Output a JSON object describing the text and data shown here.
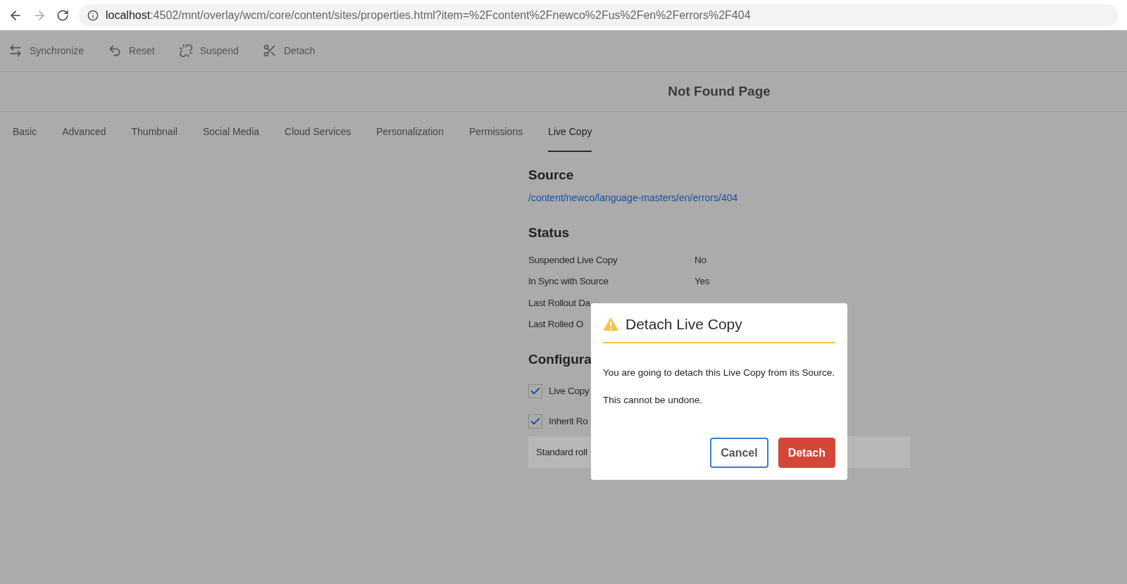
{
  "browser": {
    "host": "localhost",
    "path": ":4502/mnt/overlay/wcm/core/content/sites/properties.html?item=%2Fcontent%2Fnewco%2Fus%2Fen%2Ferrors%2F404"
  },
  "toolbar": [
    {
      "label": "Synchronize",
      "kind": "sync"
    },
    {
      "label": "Reset",
      "kind": "reset"
    },
    {
      "label": "Suspend",
      "kind": "suspend"
    },
    {
      "label": "Detach",
      "kind": "detach"
    }
  ],
  "title": "Not Found Page",
  "tabs": [
    {
      "label": "Basic",
      "selected": false
    },
    {
      "label": "Advanced",
      "selected": false
    },
    {
      "label": "Thumbnail",
      "selected": false
    },
    {
      "label": "Social Media",
      "selected": false
    },
    {
      "label": "Cloud Services",
      "selected": false
    },
    {
      "label": "Personalization",
      "selected": false
    },
    {
      "label": "Permissions",
      "selected": false
    },
    {
      "label": "Live Copy",
      "selected": true
    }
  ],
  "source": {
    "heading": "Source",
    "link": "/content/newco/language-masters/en/errors/404"
  },
  "status": {
    "heading": "Status",
    "rows": [
      {
        "label": "Suspended Live Copy",
        "value": "No"
      },
      {
        "label": "In Sync with Source",
        "value": "Yes"
      },
      {
        "label": "Last Rollout Da"
      },
      {
        "label": "Last Rolled O"
      }
    ]
  },
  "configuration": {
    "heading": "Configura",
    "options": [
      {
        "label": "Live Copy",
        "checked": true
      },
      {
        "label": "Inherit Ro",
        "checked": true
      }
    ],
    "select": "Standard roll"
  },
  "dialog": {
    "title": "Detach Live Copy",
    "message": "You are going to detach this Live Copy from its Source.",
    "note": "This cannot be undone.",
    "cancel": "Cancel",
    "confirm": "Detach"
  }
}
